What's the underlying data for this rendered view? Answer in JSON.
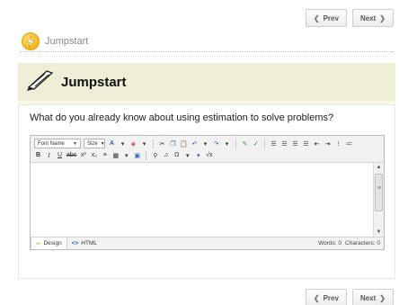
{
  "nav": {
    "prev_label": "Prev",
    "next_label": "Next",
    "prev_icon": "chevron-left-icon",
    "next_icon": "chevron-right-icon"
  },
  "header": {
    "title": "Jumpstart",
    "icon": "lightning-bolt-icon",
    "accent": "#f3b21a"
  },
  "panel": {
    "title": "Jumpstart",
    "icon": "quill-pen-icon",
    "background": "#f8f8e8",
    "header_background": "#efeed6"
  },
  "question": "What do you already know about using estimation to solve problems?",
  "editor": {
    "font_name": "Font Name",
    "size": "Size",
    "mode_design": "Design",
    "mode_html": "HTML",
    "words_label": "Words: 0",
    "characters_label": "Characters: 0"
  }
}
